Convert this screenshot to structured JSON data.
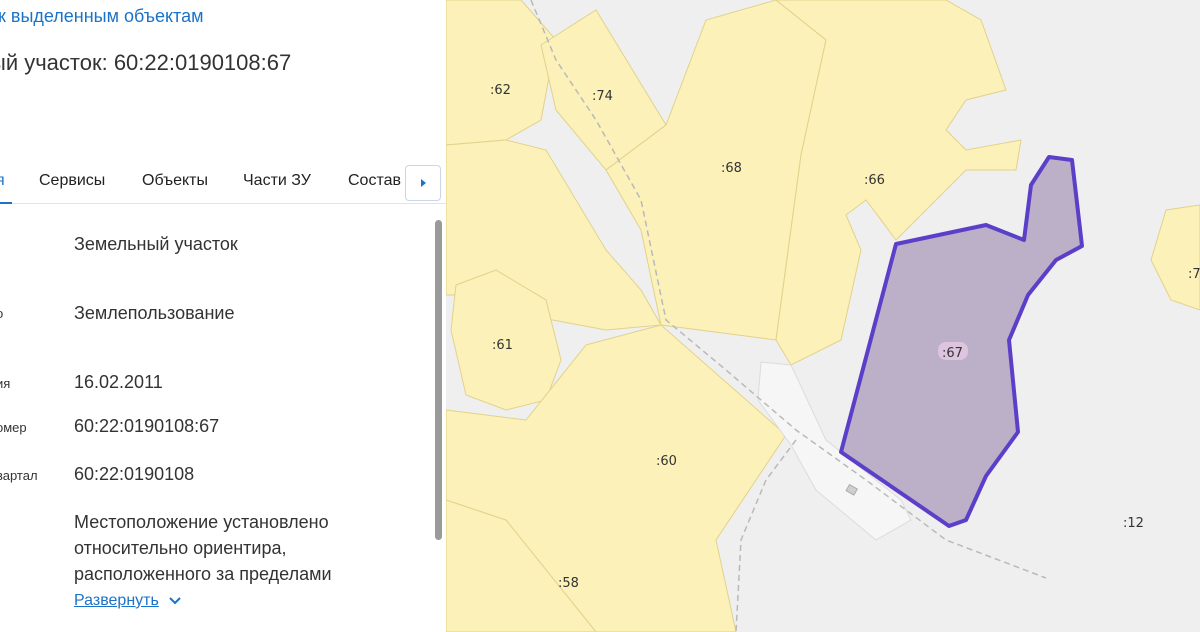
{
  "panel": {
    "back_link": "к выделенным объектам",
    "title": "ый участок: 60:22:0190108:67",
    "tabs": [
      {
        "label": "я",
        "active": true
      },
      {
        "label": "Сервисы",
        "active": false
      },
      {
        "label": "Объекты",
        "active": false
      },
      {
        "label": "Части ЗУ",
        "active": false
      },
      {
        "label": "Состав",
        "active": false
      }
    ],
    "rows": [
      {
        "label": "",
        "value": "Земельный участок"
      },
      {
        "label": "о",
        "value": "Землепользование"
      },
      {
        "label": "ия",
        "value": "16.02.2011"
      },
      {
        "label": "омер",
        "value": "60:22:0190108:67"
      },
      {
        "label": "вартал",
        "value": "60:22:0190108"
      },
      {
        "label": "",
        "value": "Местоположение установлено относительно ориентира, расположенного за пределами"
      }
    ],
    "expand_label": "Развернуть"
  },
  "map": {
    "colors": {
      "background": "#efefef",
      "parcel_fill": "#fbf1b9",
      "parcel_stroke": "#e2d28a",
      "selected_fill": "#bcb0c8",
      "selected_stroke": "#5b3fc9",
      "road": "#f6f6f6"
    },
    "plot_labels": [
      ":62",
      ":74",
      ":68",
      ":66",
      ":61",
      ":67",
      ":60",
      ":12",
      ":58",
      ":7"
    ],
    "selected_plot": ":67"
  }
}
